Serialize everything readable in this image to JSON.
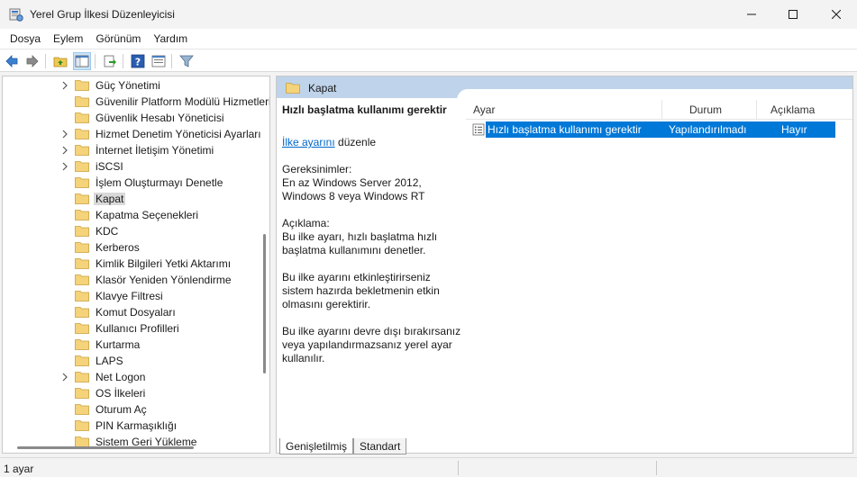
{
  "window": {
    "title": "Yerel Grup İlkesi Düzenleyicisi"
  },
  "menu": [
    "Dosya",
    "Eylem",
    "Görünüm",
    "Yardım"
  ],
  "tree": [
    {
      "label": "Güç Yönetimi",
      "expandable": true
    },
    {
      "label": "Güvenilir Platform Modülü Hizmetleri",
      "expandable": false
    },
    {
      "label": "Güvenlik Hesabı Yöneticisi",
      "expandable": false
    },
    {
      "label": "Hizmet Denetim Yöneticisi Ayarları",
      "expandable": true
    },
    {
      "label": "İnternet İletişim Yönetimi",
      "expandable": true
    },
    {
      "label": "iSCSI",
      "expandable": true
    },
    {
      "label": "İşlem Oluşturmayı Denetle",
      "expandable": false
    },
    {
      "label": "Kapat",
      "expandable": false,
      "selected": true
    },
    {
      "label": "Kapatma Seçenekleri",
      "expandable": false
    },
    {
      "label": "KDC",
      "expandable": false
    },
    {
      "label": "Kerberos",
      "expandable": false
    },
    {
      "label": "Kimlik Bilgileri Yetki Aktarımı",
      "expandable": false
    },
    {
      "label": "Klasör Yeniden Yönlendirme",
      "expandable": false
    },
    {
      "label": "Klavye Filtresi",
      "expandable": false
    },
    {
      "label": "Komut Dosyaları",
      "expandable": false
    },
    {
      "label": "Kullanıcı Profilleri",
      "expandable": false
    },
    {
      "label": "Kurtarma",
      "expandable": false
    },
    {
      "label": "LAPS",
      "expandable": false
    },
    {
      "label": "Net Logon",
      "expandable": true
    },
    {
      "label": "OS İlkeleri",
      "expandable": false
    },
    {
      "label": "Oturum Aç",
      "expandable": false
    },
    {
      "label": "PIN Karmaşıklığı",
      "expandable": false
    },
    {
      "label": "Sistem Geri Yükleme",
      "expandable": false
    }
  ],
  "right_header": {
    "title": "Kapat"
  },
  "description": {
    "title": "Hızlı başlatma kullanımı gerektir",
    "link_text": "İlke ayarını",
    "link_suffix": " düzenle",
    "requirements_label": "Gereksinimler:",
    "requirements_text": "En az Windows Server 2012, Windows 8 veya Windows RT",
    "description_label": "Açıklama:",
    "paragraph1": "Bu ilke ayarı, hızlı başlatma hızlı başlatma kullanımını denetler.",
    "paragraph2": "Bu ilke ayarını etkinleştirirseniz sistem hazırda bekletmenin etkin olmasını gerektirir.",
    "paragraph3": "Bu ilke ayarını devre dışı bırakırsanız veya yapılandırmazsanız yerel ayar kullanılır."
  },
  "table": {
    "columns": [
      "Ayar",
      "Durum",
      "Açıklama"
    ],
    "rows": [
      {
        "setting": "Hızlı başlatma kullanımı gerektir",
        "state": "Yapılandırılmadı",
        "comment": "Hayır"
      }
    ]
  },
  "tabs": [
    "Genişletilmiş",
    "Standart"
  ],
  "status": {
    "text": "1 ayar"
  },
  "colors": {
    "selection": "#0078d7",
    "header_bar": "#bfd3ea",
    "link": "#0066cc",
    "folder": "#f5d37a"
  }
}
